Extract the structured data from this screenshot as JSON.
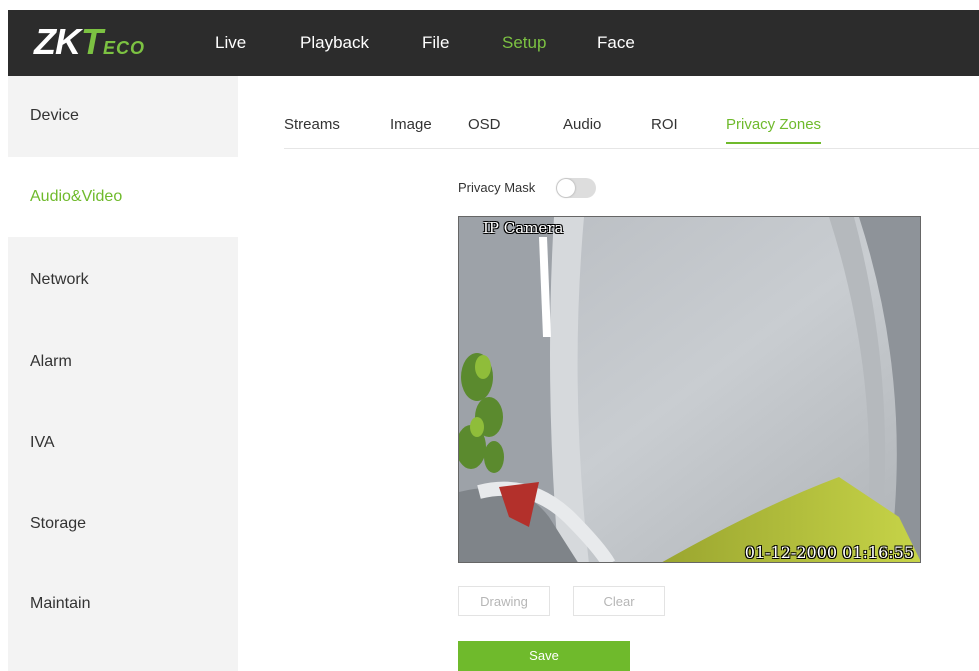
{
  "brand": {
    "part1": "ZK",
    "part2": "T",
    "part3": "ECO"
  },
  "topnav": {
    "items": [
      {
        "label": "Live"
      },
      {
        "label": "Playback"
      },
      {
        "label": "File"
      },
      {
        "label": "Setup",
        "active": true
      },
      {
        "label": "Face"
      }
    ]
  },
  "sidebar": {
    "items": [
      {
        "label": "Device"
      },
      {
        "label": "Audio&Video",
        "active": true
      },
      {
        "label": "Network"
      },
      {
        "label": "Alarm"
      },
      {
        "label": "IVA"
      },
      {
        "label": "Storage"
      },
      {
        "label": "Maintain"
      }
    ]
  },
  "tabs": {
    "items": [
      {
        "label": "Streams"
      },
      {
        "label": "Image"
      },
      {
        "label": "OSD"
      },
      {
        "label": "Audio"
      },
      {
        "label": "ROI"
      },
      {
        "label": "Privacy Zones",
        "active": true
      }
    ]
  },
  "privacy": {
    "mask_label": "Privacy Mask",
    "mask_enabled": false
  },
  "video": {
    "osd_title": "IP Camera",
    "osd_time": "01-12-2000 01:16:55"
  },
  "actions": {
    "drawing_label": "Drawing",
    "clear_label": "Clear",
    "save_label": "Save"
  },
  "colors": {
    "accent": "#6fba2c",
    "topbar": "#2c2c2c",
    "sidebar": "#f3f3f3"
  }
}
